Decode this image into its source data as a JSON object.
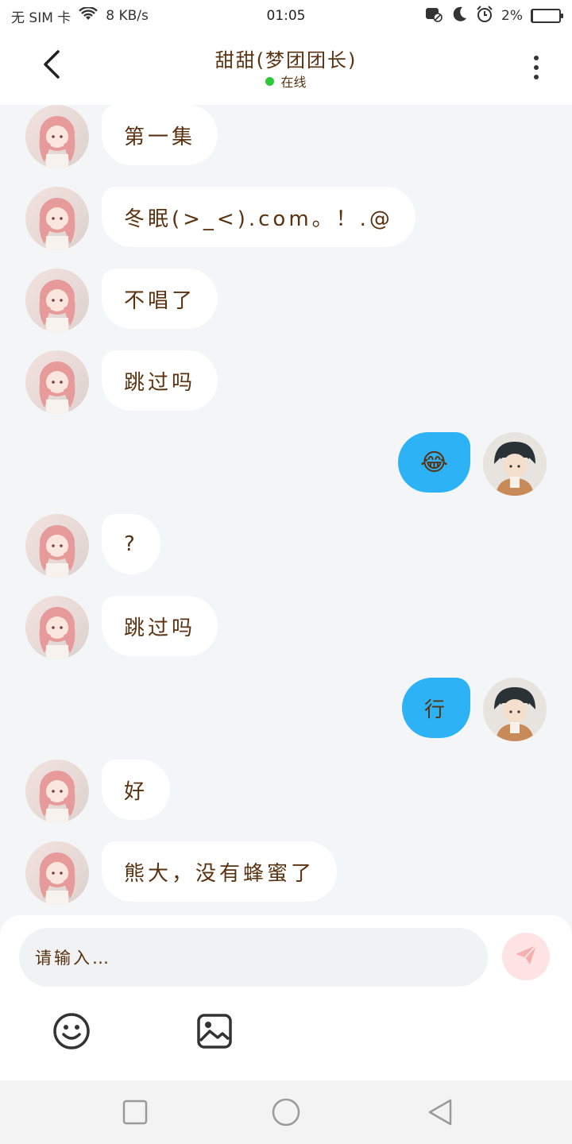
{
  "status_bar": {
    "carrier": "无 SIM 卡",
    "speed": "8 KB/s",
    "time": "01:05",
    "battery": "2%",
    "battery_level": 0.02
  },
  "header": {
    "title": "甜甜(梦团团长)",
    "status": "在线",
    "status_color": "#2fc73c"
  },
  "messages": [
    {
      "side": "left",
      "text": "第一集"
    },
    {
      "side": "left",
      "text": "冬眠(>_<).com。！.@"
    },
    {
      "side": "left",
      "text": "不唱了"
    },
    {
      "side": "left",
      "text": "跳过吗"
    },
    {
      "side": "right",
      "text": "😂"
    },
    {
      "side": "left",
      "text": "?"
    },
    {
      "side": "left",
      "text": "跳过吗"
    },
    {
      "side": "right",
      "text": "行"
    },
    {
      "side": "left",
      "text": "好"
    },
    {
      "side": "left",
      "text": "熊大，没有蜂蜜了"
    }
  ],
  "input": {
    "placeholder": "请输入…"
  },
  "colors": {
    "accent": "#2db3f5",
    "text": "#5a3210",
    "send_button": "#fde3e3"
  },
  "icons": {
    "back": "chevron-left-icon",
    "more": "more-vertical-icon",
    "send": "send-icon",
    "emoji": "emoji-icon",
    "image": "image-icon",
    "nav_recent": "square-icon",
    "nav_home": "circle-icon",
    "nav_back": "triangle-back-icon"
  }
}
